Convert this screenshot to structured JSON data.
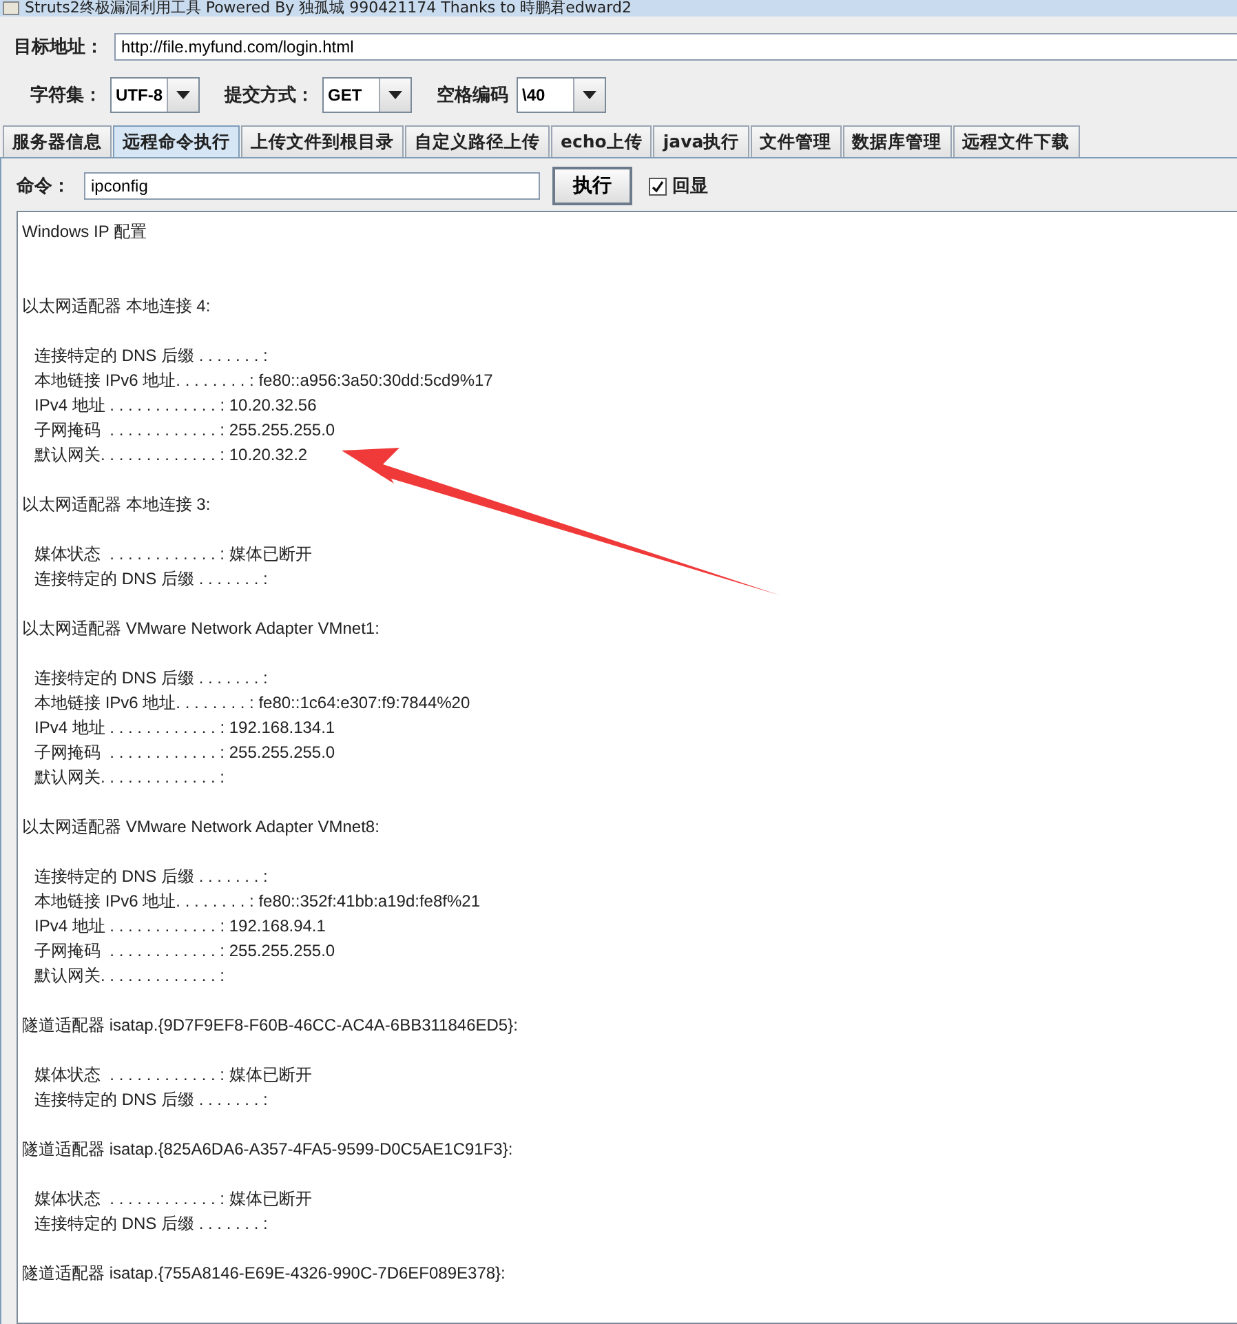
{
  "window": {
    "title": "Struts2终极漏洞利用工具  Powered By 独孤城 990421174 Thanks to 時鹏君edward2"
  },
  "target": {
    "label": "目标地址：",
    "value": "http://file.myfund.com/login.html"
  },
  "options": [
    {
      "label": "字符集：",
      "value": "UTF-8"
    },
    {
      "label": "提交方式：",
      "value": "GET"
    },
    {
      "label": "空格编码",
      "value": "\\40"
    }
  ],
  "tabs": [
    {
      "label": "服务器信息",
      "selected": false
    },
    {
      "label": "远程命令执行",
      "selected": true
    },
    {
      "label": "上传文件到根目录",
      "selected": false
    },
    {
      "label": "自定义路径上传",
      "selected": false
    },
    {
      "label": "echo上传",
      "selected": false
    },
    {
      "label": "java执行",
      "selected": false
    },
    {
      "label": "文件管理",
      "selected": false
    },
    {
      "label": "数据库管理",
      "selected": false
    },
    {
      "label": "远程文件下载",
      "selected": false
    }
  ],
  "command": {
    "label": "命令：",
    "value": "ipconfig",
    "button": "执行",
    "echo": {
      "label": "回显",
      "checked": true
    }
  },
  "output": [
    {
      "heading": "Windows IP 配置"
    },
    {
      "heading": "以太网适配器 本地连接 4:",
      "lines": [
        "连接特定的 DNS 后缀 . . . . . . . :",
        "本地链接 IPv6 地址. . . . . . . . : fe80::a956:3a50:30dd:5cd9%17",
        "IPv4 地址 . . . . . . . . . . . . : 10.20.32.56",
        "子网掩码  . . . . . . . . . . . . : 255.255.255.0",
        "默认网关. . . . . . . . . . . . . : 10.20.32.2"
      ]
    },
    {
      "heading": "以太网适配器 本地连接 3:",
      "lines": [
        "媒体状态  . . . . . . . . . . . . : 媒体已断开",
        "连接特定的 DNS 后缀 . . . . . . . :"
      ]
    },
    {
      "heading": "以太网适配器 VMware Network Adapter VMnet1:",
      "lines": [
        "连接特定的 DNS 后缀 . . . . . . . :",
        "本地链接 IPv6 地址. . . . . . . . : fe80::1c64:e307:f9:7844%20",
        "IPv4 地址 . . . . . . . . . . . . : 192.168.134.1",
        "子网掩码  . . . . . . . . . . . . : 255.255.255.0",
        "默认网关. . . . . . . . . . . . . :"
      ]
    },
    {
      "heading": "以太网适配器 VMware Network Adapter VMnet8:",
      "lines": [
        "连接特定的 DNS 后缀 . . . . . . . :",
        "本地链接 IPv6 地址. . . . . . . . : fe80::352f:41bb:a19d:fe8f%21",
        "IPv4 地址 . . . . . . . . . . . . : 192.168.94.1",
        "子网掩码  . . . . . . . . . . . . : 255.255.255.0",
        "默认网关. . . . . . . . . . . . . :"
      ]
    },
    {
      "heading": "隧道适配器 isatap.{9D7F9EF8-F60B-46CC-AC4A-6BB311846ED5}:",
      "lines": [
        "媒体状态  . . . . . . . . . . . . : 媒体已断开",
        "连接特定的 DNS 后缀 . . . . . . . :"
      ]
    },
    {
      "heading": "隧道适配器 isatap.{825A6DA6-A357-4FA5-9599-D0C5AE1C91F3}:",
      "lines": [
        "媒体状态  . . . . . . . . . . . . : 媒体已断开",
        "连接特定的 DNS 后缀 . . . . . . . :"
      ]
    },
    {
      "heading": "隧道适配器 isatap.{755A8146-E69E-4326-990C-7D6EF089E378}:"
    }
  ]
}
